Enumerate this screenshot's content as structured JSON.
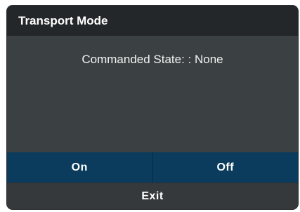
{
  "dialog": {
    "title": "Transport Mode",
    "state_text": "Commanded State: : None",
    "buttons": {
      "on_label": "On",
      "off_label": "Off",
      "exit_label": "Exit"
    }
  },
  "colors": {
    "title_bar": "#242729",
    "body": "#3b4043",
    "button_bg": "#0b3c5d",
    "text": "#ffffff"
  }
}
